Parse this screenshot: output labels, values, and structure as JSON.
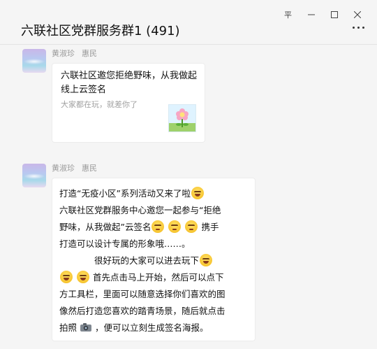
{
  "window": {
    "pin_label": "平",
    "controls": [
      "pin-icon",
      "minimize-icon",
      "maximize-icon",
      "close-icon"
    ]
  },
  "chat": {
    "title": "六联社区党群服务群1 (491)"
  },
  "messages": [
    {
      "sender": "黄淑珍",
      "role": "惠民",
      "type": "card",
      "card_title": "六联社区邀您拒绝野味，从我做起线上云签名",
      "card_subtitle": "大家都在玩，就差你了",
      "thumb_icon": "flower-icon"
    },
    {
      "sender": "黄淑珍",
      "role": "惠民",
      "type": "text",
      "lines": [
        "打造“无疫小区”系列活动又来了啦",
        "六联社区党群服务中心邀您一起参与“拒绝",
        "野味，从我做起”云签名",
        "携手",
        "打造可以设计专属的形象哦……。",
        "很好玩的大家可以进去玩下",
        "首先点击马上开始，然后可以点下",
        "方工具栏，里面可以随意选择你们喜欢的图",
        "像然后打造您喜欢的踏青场景，随后就点击",
        "拍照",
        "，便可以立刻生成签名海报。"
      ]
    }
  ]
}
